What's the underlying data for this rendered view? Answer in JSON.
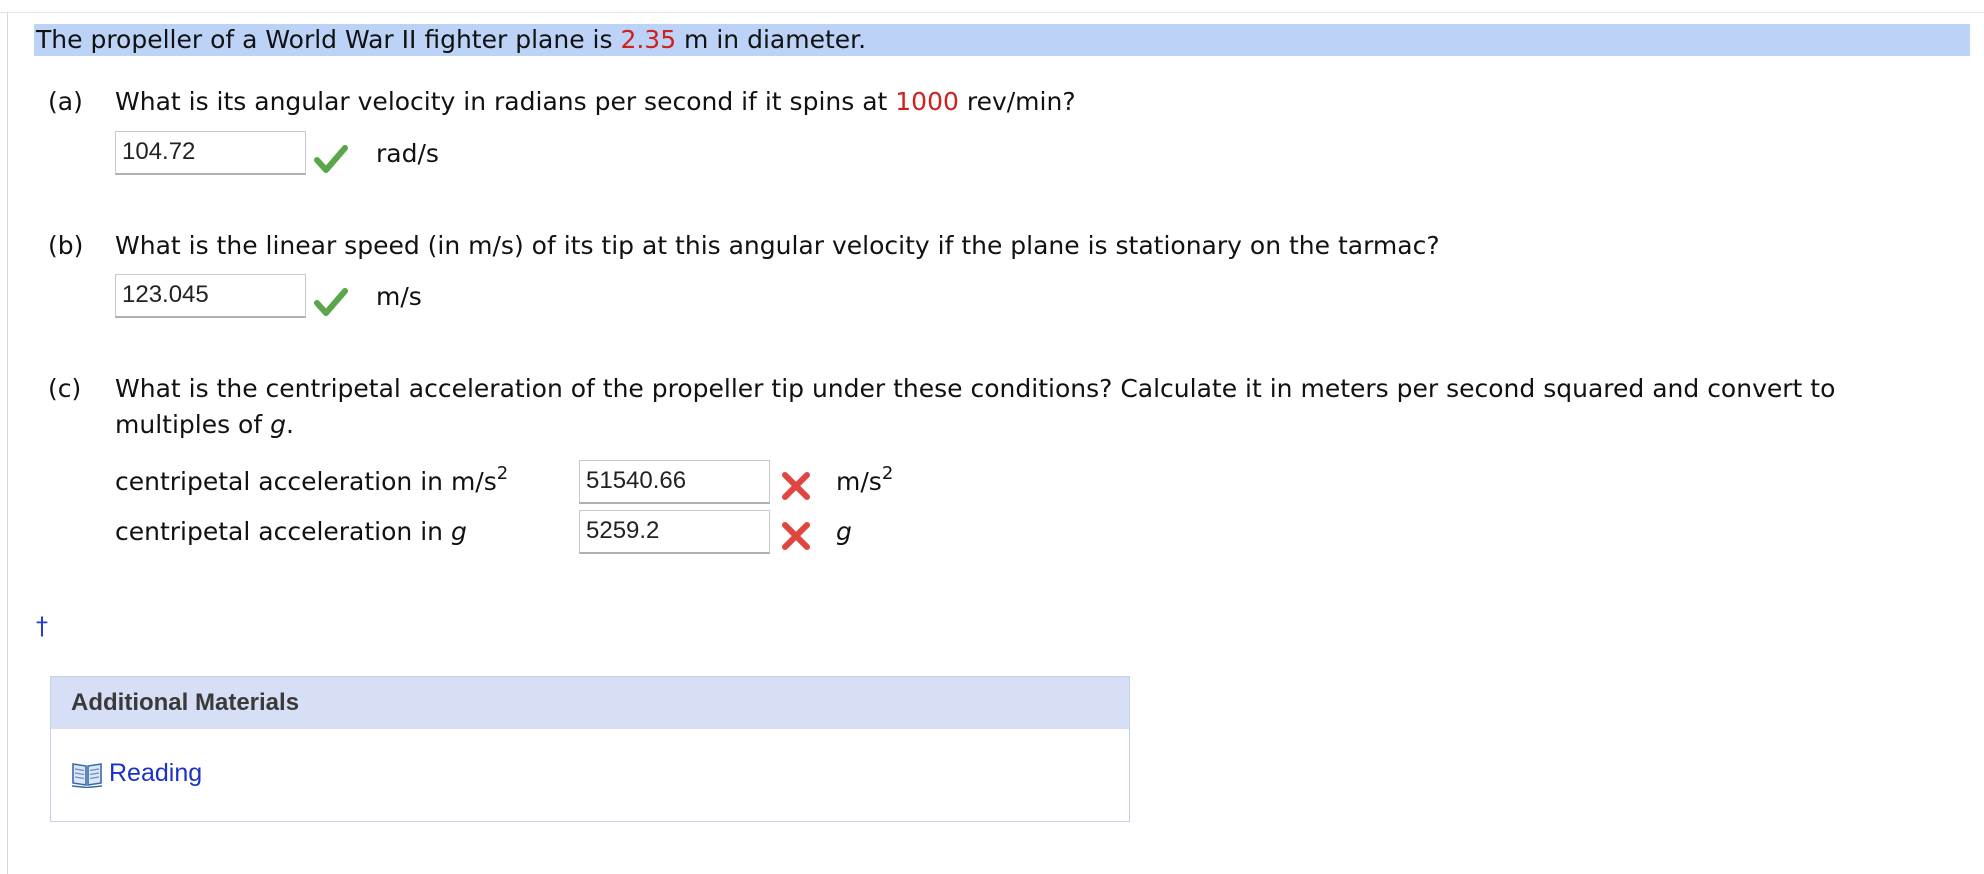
{
  "problem": {
    "stem_before": "The propeller of a World War II fighter plane is ",
    "stem_value": "2.35",
    "stem_after": " m in diameter."
  },
  "parts": {
    "a": {
      "label": "(a)",
      "question_before": "What is its angular velocity in radians per second if it spins at ",
      "question_value": "1000",
      "question_after": " rev/min?",
      "answer": "104.72",
      "status": "correct",
      "unit": "rad/s"
    },
    "b": {
      "label": "(b)",
      "question": "What is the linear speed (in m/s) of its tip at this angular velocity if the plane is stationary on the tarmac?",
      "answer": "123.045",
      "status": "correct",
      "unit": "m/s"
    },
    "c": {
      "label": "(c)",
      "question_line1": "What is the centripetal acceleration of the propeller tip under these conditions? Calculate it in meters per second squared and convert to",
      "question_line2_before": "multiples of ",
      "question_line2_var": "g",
      "question_line2_after": ".",
      "rows": [
        {
          "label": "centripetal acceleration in m/s",
          "label_sup": "2",
          "answer": "51540.66",
          "status": "incorrect",
          "unit": "m/s",
          "unit_sup": "2"
        },
        {
          "label": "centripetal acceleration in ",
          "label_var": "g",
          "answer": "5259.2",
          "status": "incorrect",
          "unit_var": "g"
        }
      ]
    }
  },
  "footnote_symbol": "†",
  "materials": {
    "header": "Additional Materials",
    "link_label": "Reading",
    "link_icon": "book-icon"
  },
  "colors": {
    "stem_highlight": "#bcd3f7",
    "given_value": "#d0201a",
    "correct_check": "#5aa64a",
    "incorrect_x": "#e0463f",
    "link": "#1a32c8",
    "materials_header_bg": "#d6dff5"
  }
}
